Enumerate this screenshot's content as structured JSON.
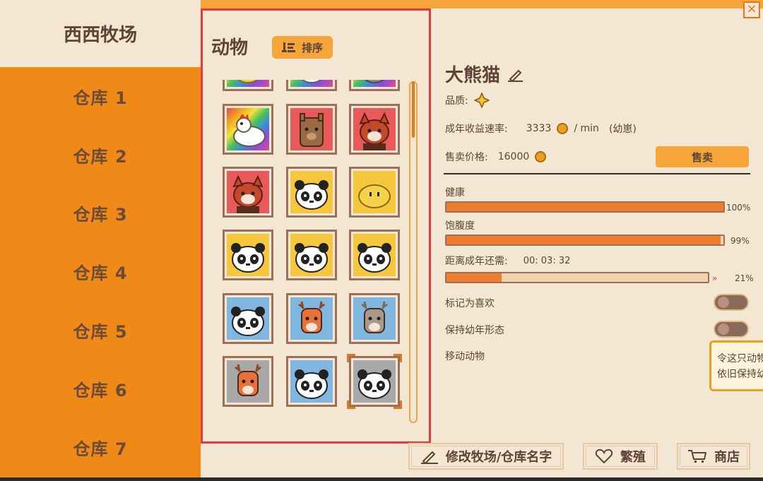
{
  "sidebar": {
    "title": "西西牧场",
    "items": [
      "仓库 1",
      "仓库 2",
      "仓库 3",
      "仓库 4",
      "仓库 5",
      "仓库 6",
      "仓库 7"
    ]
  },
  "panel": {
    "title": "动物",
    "sort_label": "排序"
  },
  "animals": [
    {
      "kind": "chick",
      "bg": "rainbow"
    },
    {
      "kind": "cat-white",
      "bg": "rainbow"
    },
    {
      "kind": "cat-gray",
      "bg": "rainbow"
    },
    {
      "kind": "chicken",
      "bg": "rainbow"
    },
    {
      "kind": "alpaca",
      "bg": "#e85a5a"
    },
    {
      "kind": "red-panda",
      "bg": "#e85a5a"
    },
    {
      "kind": "red-panda",
      "bg": "#e85a5a"
    },
    {
      "kind": "panda",
      "bg": "#f6c63c"
    },
    {
      "kind": "slime",
      "bg": "#f6c63c"
    },
    {
      "kind": "panda",
      "bg": "#f6c63c"
    },
    {
      "kind": "panda",
      "bg": "#f6c63c"
    },
    {
      "kind": "panda",
      "bg": "#f6c63c"
    },
    {
      "kind": "panda",
      "bg": "#7fb7e0"
    },
    {
      "kind": "deer",
      "bg": "#7fb7e0"
    },
    {
      "kind": "deer-gray",
      "bg": "#7fb7e0"
    },
    {
      "kind": "deer",
      "bg": "#a8a8a8"
    },
    {
      "kind": "panda",
      "bg": "#7fb7e0"
    },
    {
      "kind": "panda",
      "bg": "#a8a8a8"
    }
  ],
  "detail": {
    "name": "大熊猫",
    "quality_label": "品质:",
    "rate_label": "成年收益速率:",
    "rate_value": "3333",
    "rate_unit": "/ min",
    "rate_note": "(幼崽)",
    "price_label": "售卖价格:",
    "price_value": "16000",
    "sell_label": "售卖",
    "health_label": "健康",
    "health_pct": "100%",
    "health_value": 1.0,
    "full_label": "饱腹度",
    "full_pct": "99%",
    "full_value": 0.99,
    "adult_label": "距离成年还需:",
    "adult_time": "00: 03: 32",
    "adult_pct": "21%",
    "adult_value": 0.21,
    "fav_label": "标记为喜欢",
    "keep_label": "保持幼年形态",
    "move_label": "移动动物"
  },
  "tooltip": {
    "line1": "令这只动物",
    "line2": "依旧保持幼"
  },
  "bottom": {
    "rename_label": "修改牧场/仓库名字",
    "breed_label": "繁殖",
    "shop_label": "商店"
  },
  "colors": {
    "accent": "#ef8a18",
    "sidebar_bg": "#ef8a18",
    "panel_bg": "#f3e6d2",
    "text": "#5e4436",
    "highlight_border": "#e53a3a",
    "bar_fill": "#ee7d2e"
  },
  "icons": [
    "close-icon",
    "sort-icon",
    "edit-icon",
    "star-icon",
    "coin-icon",
    "heart-icon",
    "shop-cart-icon",
    "pencil-icon"
  ]
}
